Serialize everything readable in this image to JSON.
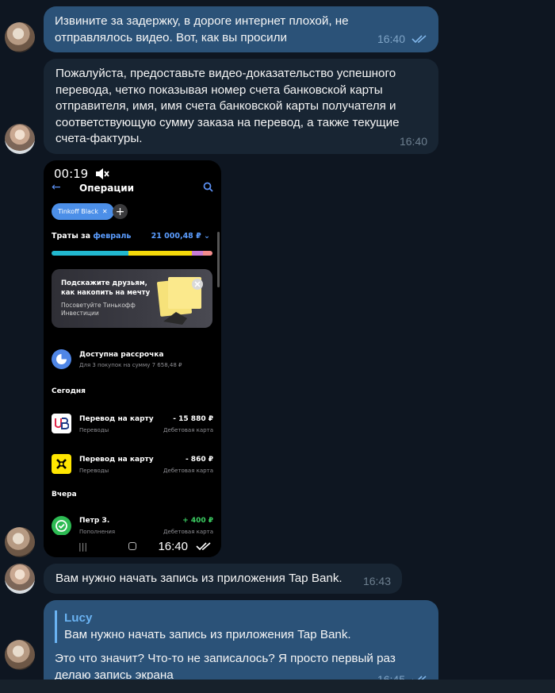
{
  "messages": {
    "m1": {
      "text": "Извините за задержку, в дороге интернет плохой, не отправлялось видео. Вот, как вы просили",
      "time": "16:40"
    },
    "m2": {
      "text": "Пожалуйста, предоставьте видео-доказательство успешного перевода, четко показывая номер счета банковской карты отправителя, имя, имя счета банковской карты получателя и соответствующую сумму заказа на перевод, а также текущие счета-фактуры.",
      "time": "16:40"
    },
    "m3": {
      "time": "16:40"
    },
    "m4": {
      "text": "Вам нужно начать запись из приложения Tap Bank.",
      "time": "16:43"
    },
    "m5": {
      "reply_name": "Lucy",
      "reply_text": "Вам нужно начать запись из приложения Tap Bank.",
      "text": "Это что значит? Что-то не записалось? Я просто первый раз делаю запись экрана",
      "time": "16:45"
    }
  },
  "phone": {
    "status_time": "00:19",
    "title": "Операции",
    "chip": "Tinkoff Black",
    "spend_prefix": "Траты за",
    "spend_month": "февраль",
    "spend_amount": "21 000,48 ₽",
    "promo_title": "Подскажите друзьям, как накопить на мечту",
    "promo_sub": "Посоветуйте Тинькофф Инвестиции",
    "installment_title": "Доступна рассрочка",
    "installment_sub": "Для 3 покупок на сумму 7 658,48 ₽",
    "today": "Сегодня",
    "yesterday": "Вчера",
    "ops": [
      {
        "title": "Перевод на карту",
        "sub": "Переводы",
        "amount": "- 15 880 ₽",
        "card": "Дебетовая карта"
      },
      {
        "title": "Перевод на карту",
        "sub": "Переводы",
        "amount": "- 860 ₽",
        "card": "Дебетовая карта"
      },
      {
        "title": "Петр З.",
        "sub": "Пополнения",
        "amount": "+ 400 ₽",
        "card": "Дебетовая карта"
      }
    ]
  },
  "colors": {
    "background": "#0e1621",
    "outgoing_bubble": "#2b5278",
    "incoming_bubble": "#182533",
    "reply_accent": "#6ab3f3"
  }
}
